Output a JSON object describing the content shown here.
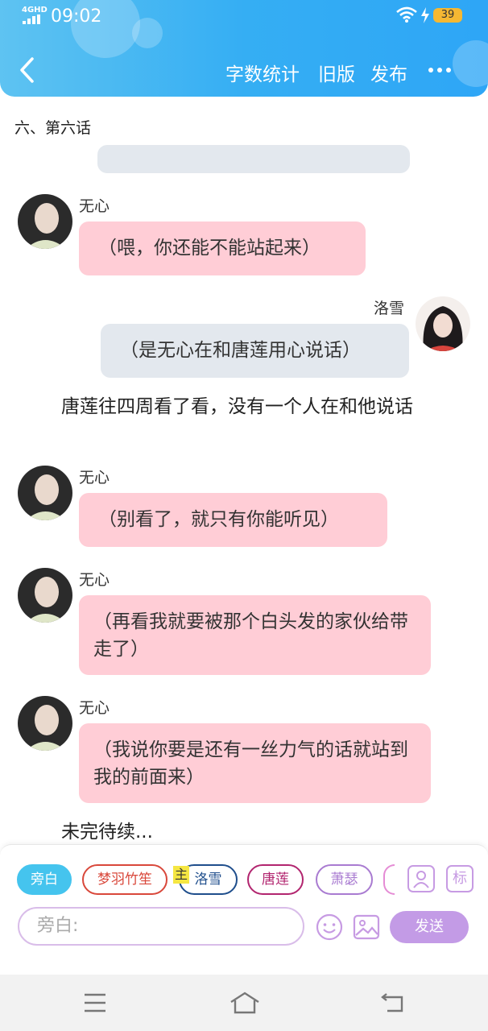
{
  "status_bar": {
    "network": "4GHD",
    "time": "09:02",
    "battery": "39"
  },
  "header": {
    "back_icon": "chevron-left-icon",
    "word_count": "字数统计",
    "old_version": "旧版",
    "publish": "发布",
    "more_icon": "more-horizontal-icon"
  },
  "chapter_title": "六、第六话",
  "chat": {
    "wuxin_name": "无心",
    "luoxue_name": "洛雪",
    "m1": "（喂，你还能不能站起来）",
    "m2": "（是无心在和唐莲用心说话）",
    "narration1": "唐莲往四周看了看，没有一个人在和他说话",
    "m3": "（别看了，就只有你能听见）",
    "m4": "（再看我就要被那个白头发的家伙给带走了）",
    "m5": "（我说你要是还有一丝力气的话就站到我的前面来）",
    "narration2": "未完待续..."
  },
  "input_panel": {
    "roles": [
      "旁白",
      "梦羽竹笙",
      "洛雪",
      "唐莲",
      "萧瑟"
    ],
    "main_tag": "主",
    "placeholder": "旁白:",
    "send_label": "发送",
    "mark_label": "标",
    "colors": {
      "narration": "#45c4ee",
      "mengyu": "#d9483b",
      "luoxue": "#1f4e8c",
      "tanglian": "#b2256f",
      "xiaose": "#a97bd1",
      "send": "#c39be6"
    }
  }
}
